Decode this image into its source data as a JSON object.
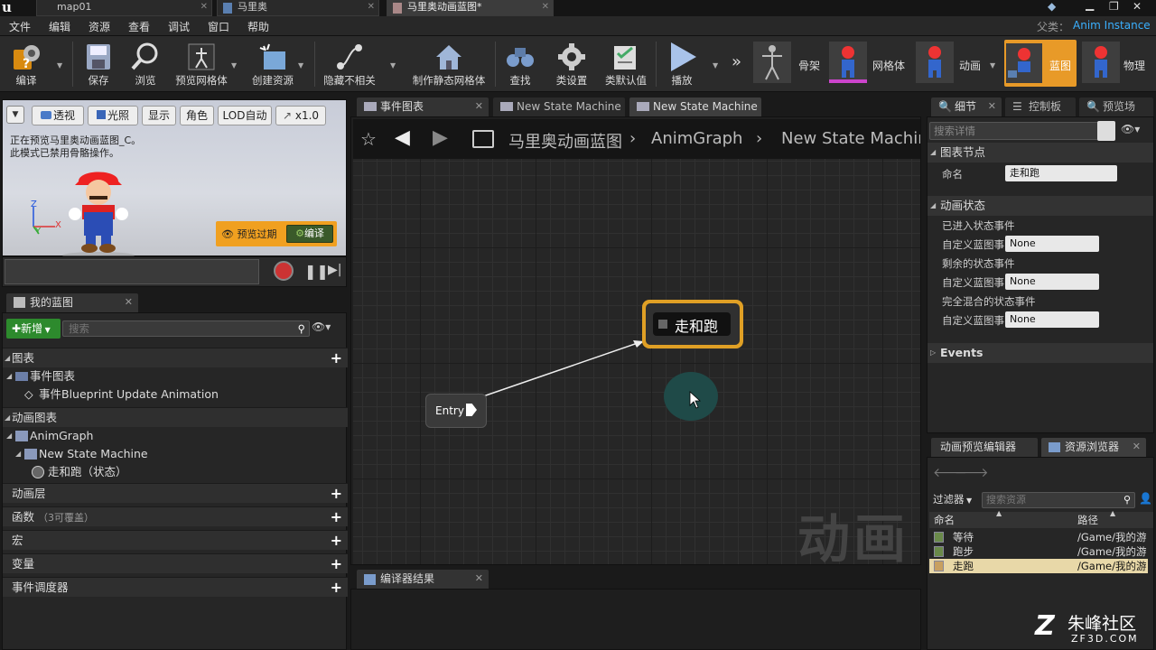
{
  "titlebar": {
    "tabs": [
      {
        "label": "map01"
      },
      {
        "label": "马里奥"
      },
      {
        "label": "马里奥动画蓝图*"
      }
    ],
    "parent_class_label": "父类：",
    "parent_class_value": "Anim Instance"
  },
  "menu": [
    "文件",
    "编辑",
    "资源",
    "查看",
    "调试",
    "窗口",
    "帮助"
  ],
  "toolbar": {
    "compile": "编译",
    "save": "保存",
    "browse": "浏览",
    "preview_mesh": "预览网格体",
    "create_asset": "创建资源",
    "hide_unrelated": "隐藏不相关",
    "make_static_mesh": "制作静态网格体",
    "find": "查找",
    "class_settings": "类设置",
    "class_defaults": "类默认值",
    "play": "播放"
  },
  "modes": {
    "skeleton": "骨架",
    "mesh": "网格体",
    "animation": "动画",
    "blueprint": "蓝图",
    "physics": "物理"
  },
  "viewport": {
    "buttons": {
      "perspective": "透视",
      "lit": "光照",
      "show": "显示",
      "character": "角色",
      "lod": "LOD自动",
      "speed": "x1.0"
    },
    "info_line1": "正在预览马里奥动画蓝图_C。",
    "info_line2": "此模式已禁用骨骼操作。",
    "preview_expired": "预览过期",
    "compile_btn": "编译",
    "axis_z": "Z",
    "axis_x": "X",
    "axis_y": "Y"
  },
  "my_blueprint": {
    "tab": "我的蓝图",
    "new_btn": "新增",
    "search_placeholder": "搜索",
    "graphs": "图表",
    "event_graph": "事件图表",
    "event_bp_update": "事件Blueprint Update Animation",
    "anim_graphs": "动画图表",
    "anim_graph": "AnimGraph",
    "state_machine": "New State Machine",
    "state": "走和跑（状态）",
    "anim_layers": "动画层",
    "functions": "函数",
    "functions_note": "（3可覆盖）",
    "macros": "宏",
    "variables": "变量",
    "event_dispatchers": "事件调度器"
  },
  "graph": {
    "tabs": [
      "事件图表",
      "New State Machine",
      "New State Machine"
    ],
    "breadcrumb": [
      "马里奥动画蓝图",
      "AnimGraph",
      "New State Machine"
    ],
    "state_node": "走和跑",
    "entry_node": "Entry",
    "watermark": "动画"
  },
  "compiler": {
    "tab": "编译器结果"
  },
  "details": {
    "tabs": [
      "细节",
      "控制板",
      "预览场"
    ],
    "search_placeholder": "搜索详情",
    "graph_node_section": "图表节点",
    "name_label": "命名",
    "name_value": "走和跑",
    "anim_state_section": "动画状态",
    "entered_event": "已进入状态事件",
    "custom_bp_event": "自定义蓝图事",
    "none": "None",
    "left_event": "剩余的状态事件",
    "fully_blended_event": "完全混合的状态事件",
    "events_section": "Events"
  },
  "asset_browser": {
    "tabs": [
      "动画预览编辑器",
      "资源浏览器"
    ],
    "filter": "过滤器",
    "search_placeholder": "搜索资源",
    "col_name": "命名",
    "col_path": "路径",
    "items": [
      {
        "name": "等待",
        "path": "/Game/我的游"
      },
      {
        "name": "跑步",
        "path": "/Game/我的游"
      },
      {
        "name": "走跑",
        "path": "/Game/我的游"
      }
    ]
  },
  "watermark_site": {
    "name": "朱峰社区",
    "url": "ZF3D.COM"
  }
}
